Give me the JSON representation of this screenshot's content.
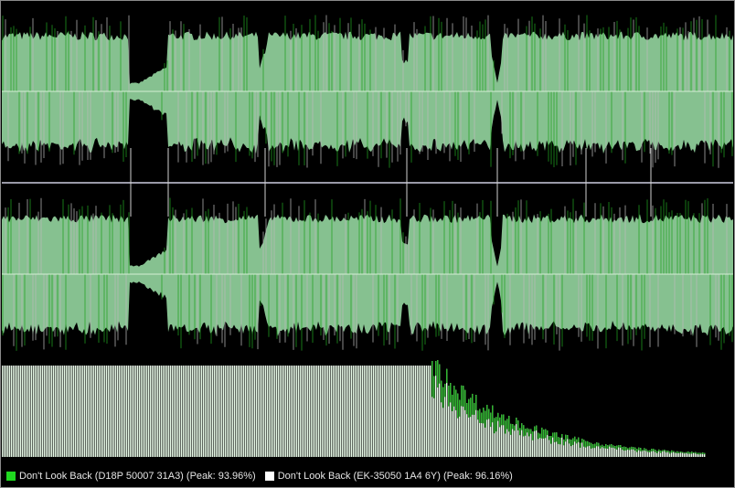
{
  "colors": {
    "background": "#000000",
    "wave_fill": "#86c190",
    "wave_spike_a": "#20a020",
    "wave_spike_b": "#b8b8b8",
    "centerline": "#d4f0d4",
    "channel_divider": "#9a9aa8",
    "track_marker": "#d0d0d0",
    "spectrum_light": "#e8fbe8",
    "spectrum_green": "#2fb82f"
  },
  "legend": [
    {
      "label": "Don't Look Back (D18P 50007 31A3) (Peak: 93.96%)",
      "color": "#1fd81f"
    },
    {
      "label": "Don't Look Back (EK-35050 1A4 6Y) (Peak: 96.16%)",
      "color": "#ffffff"
    }
  ]
}
